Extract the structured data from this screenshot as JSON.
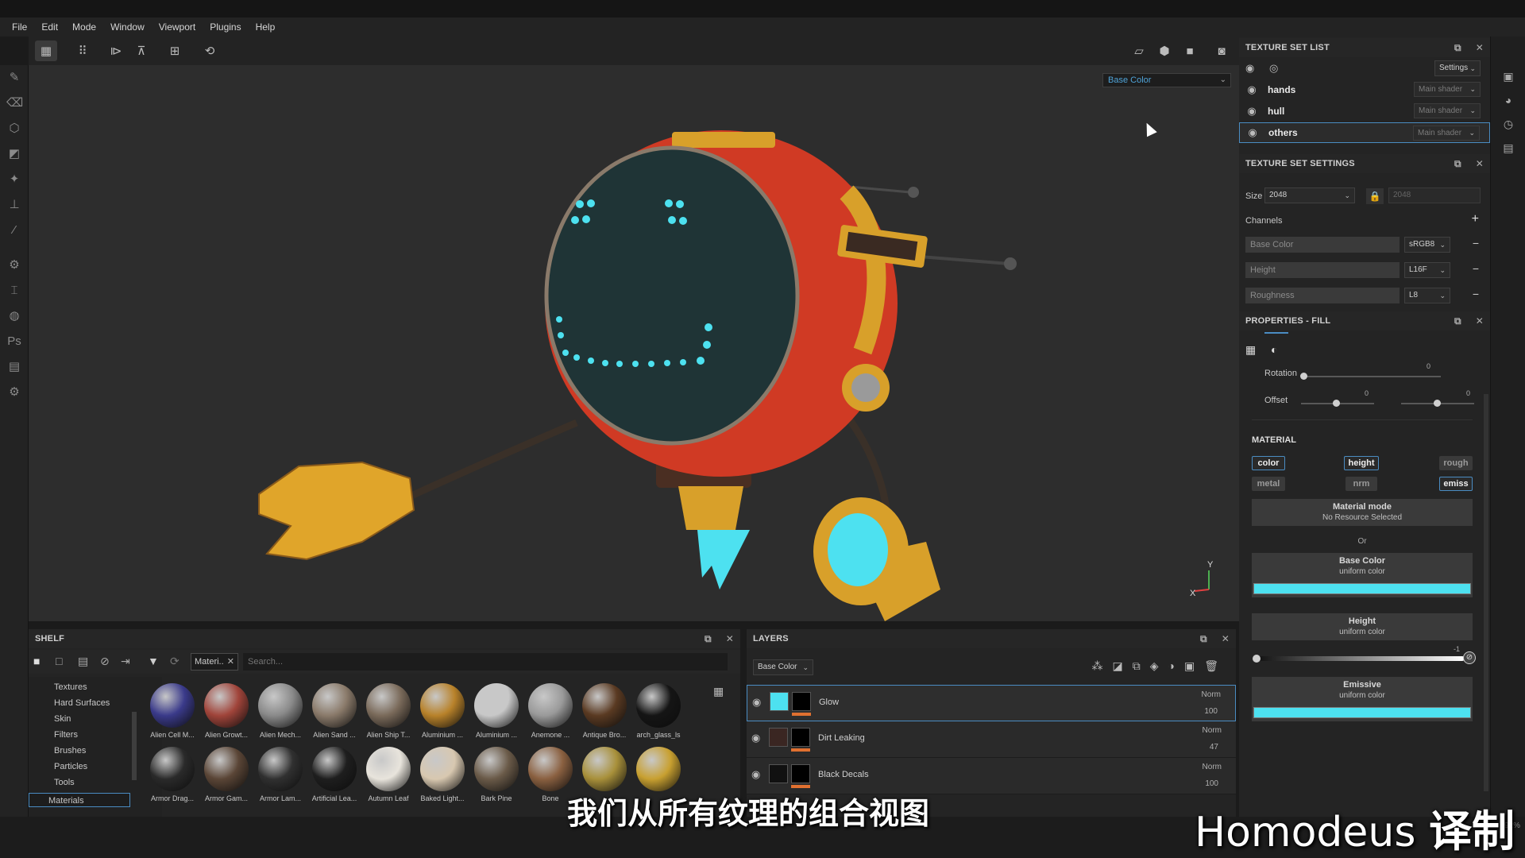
{
  "menu": [
    "File",
    "Edit",
    "Mode",
    "Window",
    "Viewport",
    "Plugins",
    "Help"
  ],
  "viewport": {
    "channel_dropdown": "Base Color",
    "axis_x": "X",
    "axis_y": "Y"
  },
  "texture_set_list": {
    "title": "TEXTURE SET LIST",
    "settings_label": "Settings",
    "items": [
      {
        "name": "hands",
        "shader": "Main shader"
      },
      {
        "name": "hull",
        "shader": "Main shader"
      },
      {
        "name": "others",
        "shader": "Main shader",
        "selected": true
      }
    ]
  },
  "texture_set_settings": {
    "title": "TEXTURE SET SETTINGS",
    "size_label": "Size",
    "size_value": "2048",
    "size_locked_value": "2048",
    "channels_label": "Channels",
    "channels": [
      {
        "name": "Base Color",
        "format": "sRGB8"
      },
      {
        "name": "Height",
        "format": "L16F"
      },
      {
        "name": "Roughness",
        "format": "L8"
      }
    ]
  },
  "properties_fill": {
    "title": "PROPERTIES - FILL",
    "rotation_label": "Rotation",
    "rotation_value": "0",
    "offset_label": "Offset",
    "offset_x": "0",
    "offset_y": "0",
    "material_heading": "MATERIAL",
    "material_buttons": [
      {
        "label": "color",
        "active": true
      },
      {
        "label": "height",
        "active": true
      },
      {
        "label": "rough",
        "active": false
      },
      {
        "label": "metal",
        "active": false
      },
      {
        "label": "nrm",
        "active": false
      },
      {
        "label": "emiss",
        "active": true
      }
    ],
    "material_mode_title": "Material mode",
    "material_mode_sub": "No Resource Selected",
    "or_label": "Or",
    "base_color_title": "Base Color",
    "base_color_sub": "uniform color",
    "height_title": "Height",
    "height_sub": "uniform color",
    "height_value": "-1",
    "emissive_title": "Emissive",
    "emissive_sub": "uniform color",
    "uniform_color": "#4de1f0"
  },
  "shelf": {
    "title": "SHELF",
    "filter_tag": "Materi..",
    "search_placeholder": "Search...",
    "categories": [
      "Textures",
      "Hard Surfaces",
      "Skin",
      "Filters",
      "Brushes",
      "Particles",
      "Tools",
      "Materials"
    ],
    "selected_category": "Materials",
    "materials": [
      {
        "label": "Alien Cell M...",
        "color": "#3a3a8a"
      },
      {
        "label": "Alien Growt...",
        "color": "#a0443a"
      },
      {
        "label": "Alien Mech...",
        "color": "#8a8a8a"
      },
      {
        "label": "Alien Sand ...",
        "color": "#8a7a6a"
      },
      {
        "label": "Alien Ship T...",
        "color": "#7a6a5a"
      },
      {
        "label": "Aluminium ...",
        "color": "#b8822a"
      },
      {
        "label": "Aluminium ...",
        "color": "#c8c8c8"
      },
      {
        "label": "Anemone ...",
        "color": "#9a9a9a"
      },
      {
        "label": "Antique Bro...",
        "color": "#5a3a22"
      },
      {
        "label": "arch_glass_ls",
        "color": "#151515"
      },
      {
        "label": "Armor Drag...",
        "color": "#2a2a2a"
      },
      {
        "label": "Armor Gam...",
        "color": "#5a4536"
      },
      {
        "label": "Armor Lam...",
        "color": "#303030"
      },
      {
        "label": "Artificial Lea...",
        "color": "#1e1e1e"
      },
      {
        "label": "Autumn Leaf",
        "color": "#e8e4dc"
      },
      {
        "label": "Baked Light...",
        "color": "#d8c8b0"
      },
      {
        "label": "Bark Pine",
        "color": "#6a5a48"
      },
      {
        "label": "Bone",
        "color": "#8a6040"
      },
      {
        "label": "",
        "color": "#a8903a"
      },
      {
        "label": "",
        "color": "#c8a030"
      }
    ]
  },
  "layers": {
    "title": "LAYERS",
    "channel_dropdown": "Base Color",
    "items": [
      {
        "name": "Glow",
        "blend": "Norm",
        "opacity": "100",
        "color": "#4de1f0",
        "selected": true
      },
      {
        "name": "Dirt Leaking",
        "blend": "Norm",
        "opacity": "47",
        "color": "#3a2622",
        "selected": false
      },
      {
        "name": "Black Decals",
        "blend": "Norm",
        "opacity": "100",
        "color": "#111111",
        "selected": false
      }
    ]
  },
  "subtitle": "我们从所有纹理的组合视图",
  "watermark": {
    "name": "Homodeus",
    "suffix": "译制"
  },
  "zoom": "92%"
}
